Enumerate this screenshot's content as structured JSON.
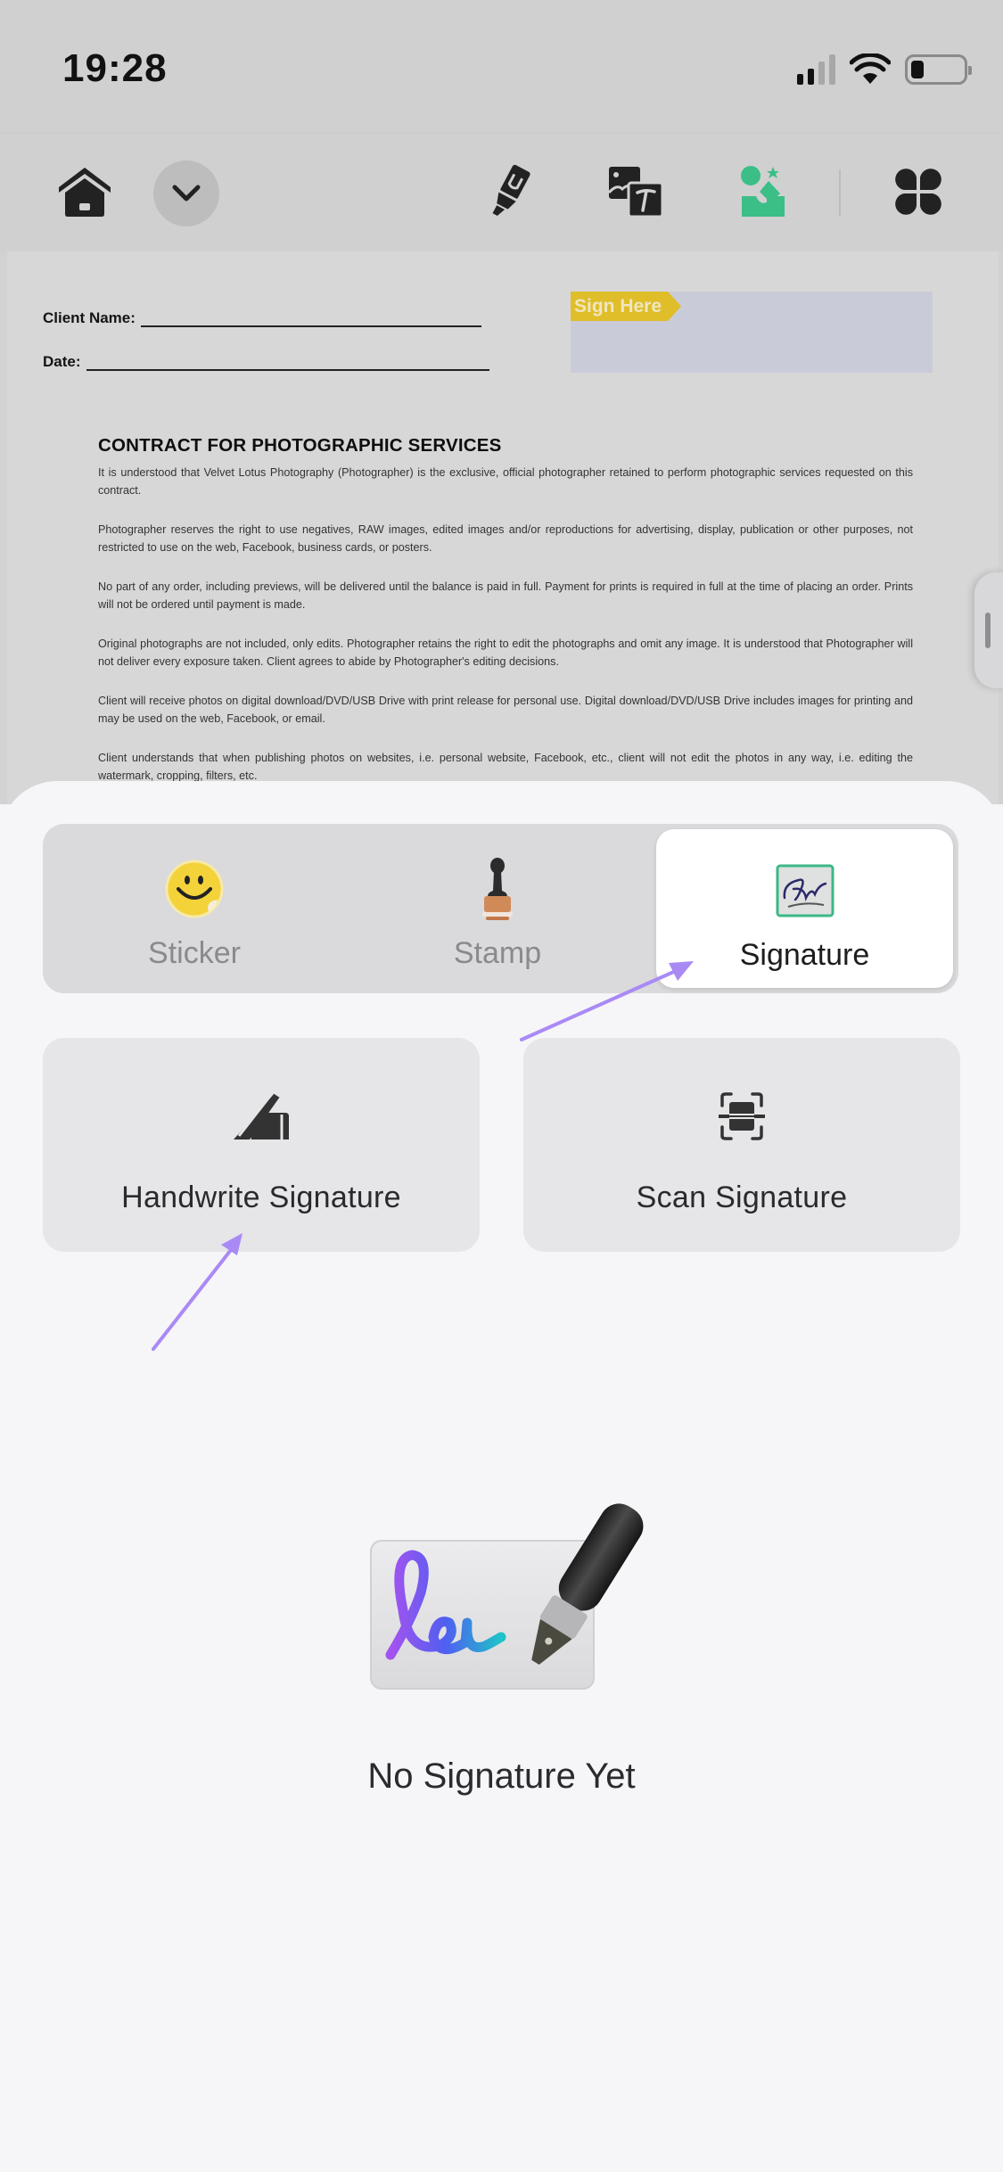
{
  "status_bar": {
    "time": "19:28",
    "icons": [
      "cellular-signal-icon",
      "wifi-icon",
      "battery-icon"
    ],
    "signal_bars_active": 2,
    "signal_bars_total": 4,
    "battery_level": 0.25
  },
  "toolbar": {
    "left_icons": [
      "home-icon",
      "chevron-down-icon"
    ],
    "right_icons": [
      "highlighter-icon",
      "image-text-icon",
      "sign-stamp-icon",
      "apps-grid-icon"
    ],
    "active_tool": "sign-stamp-icon",
    "accent_color": "#3bbf87"
  },
  "document": {
    "client_name_label": "Client Name:",
    "date_label": "Date:",
    "sign_here_label": "Sign Here",
    "title": "CONTRACT FOR PHOTOGRAPHIC SERVICES",
    "paragraphs": [
      "It is understood that Velvet Lotus Photography (Photographer) is the exclusive, official photographer retained to perform photographic services requested on this contract.",
      "Photographer reserves the right to use negatives, RAW images, edited images and/or reproductions for advertising, display, publication or other purposes, not restricted to use on the web, Facebook, business cards, or posters.",
      "No part of any order, including previews, will be delivered until the balance is paid in full. Payment for prints is required in full at the time of placing an order. Prints will not be ordered until payment is made.",
      "Original photographs are not included, only edits. Photographer retains the right to edit the photographs and omit any image. It is understood that Photographer will not deliver every exposure taken. Client agrees to abide by Photographer's editing decisions.",
      "Client will receive photos on digital download/DVD/USB Drive with print release for personal use. Digital download/DVD/USB Drive includes images for printing and may be used on the web, Facebook, or email.",
      "Client understands that when publishing photos on websites, i.e. personal website, Facebook, etc., client will not edit the photos in any way, i.e. editing the watermark, cropping, filters, etc."
    ]
  },
  "sheet": {
    "tabs": [
      {
        "label": "Sticker",
        "icon": "smiley-sticker-icon",
        "selected": false
      },
      {
        "label": "Stamp",
        "icon": "rubber-stamp-icon",
        "selected": false
      },
      {
        "label": "Signature",
        "icon": "signature-icon",
        "selected": true
      }
    ],
    "options": [
      {
        "label": "Handwrite Signature",
        "icon": "hand-pen-icon"
      },
      {
        "label": "Scan Signature",
        "icon": "scan-icon"
      }
    ],
    "empty_state": {
      "illustration": "signature-pen-illustration",
      "text": "No Signature Yet"
    }
  },
  "annotations": {
    "arrow_color": "#a98af5",
    "arrows": [
      "arrow-to-signature-tab",
      "arrow-to-handwrite-signature"
    ]
  }
}
